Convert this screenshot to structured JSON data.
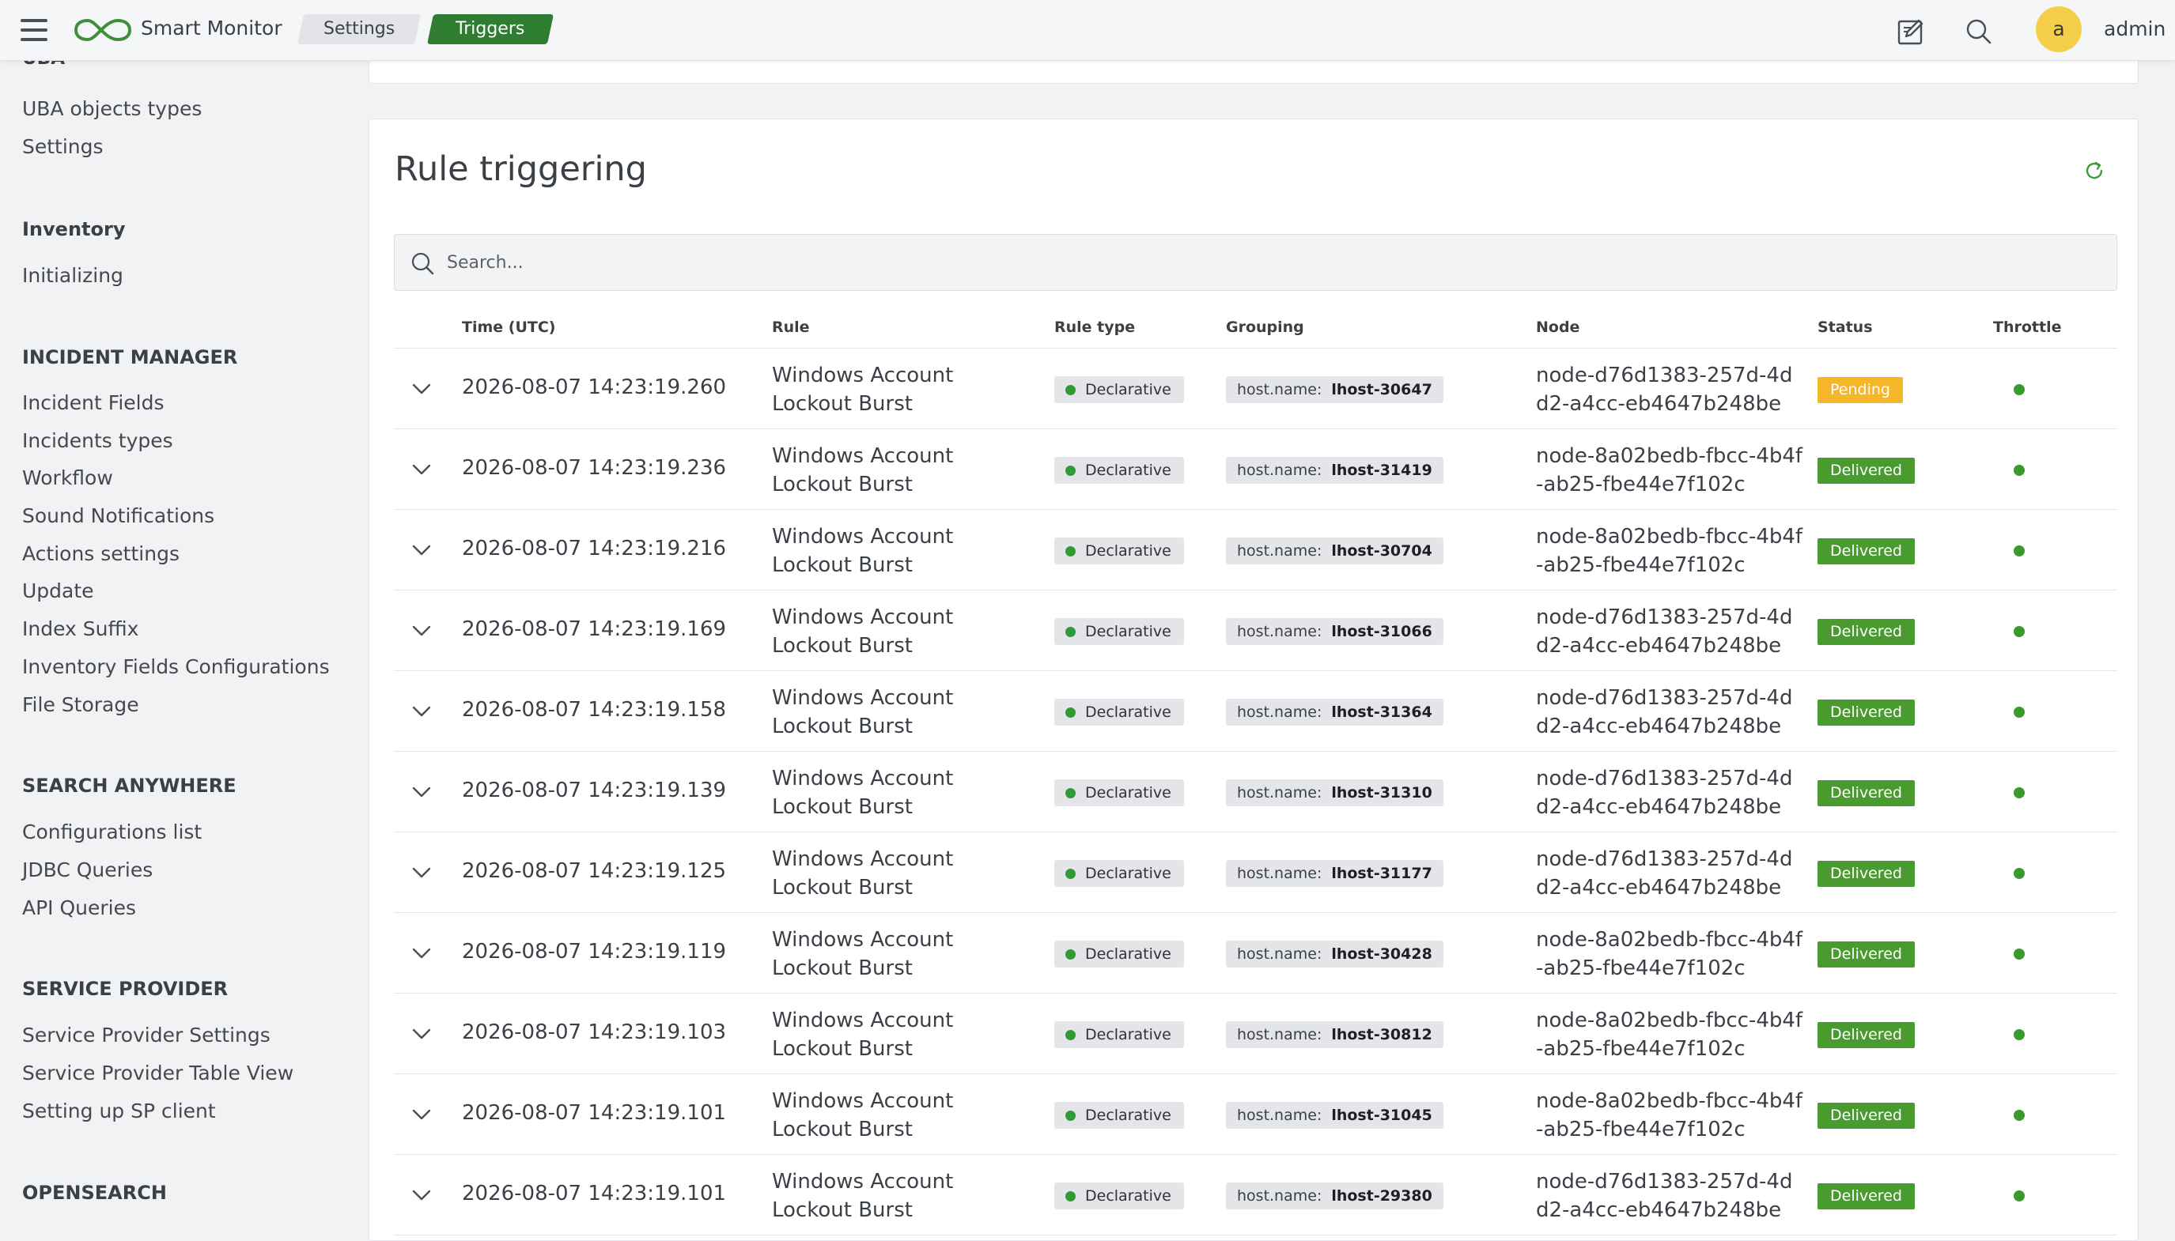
{
  "header": {
    "app_title": "Smart Monitor",
    "breadcrumbs": [
      "Settings",
      "Triggers"
    ],
    "user_initial": "a",
    "username": "admin",
    "accent_color": "#2f7d31"
  },
  "sidebar": {
    "cut_heading": "UBA",
    "sections": [
      {
        "heading": "",
        "items": [
          "UBA objects types",
          "Settings"
        ]
      },
      {
        "heading": "Inventory",
        "items": [
          "Initializing"
        ]
      },
      {
        "heading": "INCIDENT MANAGER",
        "items": [
          "Incident Fields",
          "Incidents types",
          "Workflow",
          "Sound Notifications",
          "Actions settings",
          "Update",
          "Index Suffix",
          "Inventory Fields Configurations",
          "File Storage"
        ]
      },
      {
        "heading": "SEARCH ANYWHERE",
        "items": [
          "Configurations list",
          "JDBC Queries",
          "API Queries"
        ]
      },
      {
        "heading": "SERVICE PROVIDER",
        "items": [
          "Service Provider Settings",
          "Service Provider Table View",
          "Setting up SP client"
        ]
      },
      {
        "heading": "OPENSEARCH",
        "items": []
      }
    ]
  },
  "main": {
    "title": "Rule triggering",
    "search_placeholder": "Search...",
    "columns": [
      "Time (UTC)",
      "Rule",
      "Rule type",
      "Grouping",
      "Node",
      "Status",
      "Throttle"
    ],
    "rows": [
      {
        "time": "2026-08-07 14:23:19.260",
        "rule": "Windows Account Lockout Burst",
        "rule_type": "Declarative",
        "group_key": "host.name:",
        "group_value": "lhost-30647",
        "node": "node-d76d1383-257d-4dd2-a4cc-eb4647b248be",
        "status": "Pending"
      },
      {
        "time": "2026-08-07 14:23:19.236",
        "rule": "Windows Account Lockout Burst",
        "rule_type": "Declarative",
        "group_key": "host.name:",
        "group_value": "lhost-31419",
        "node": "node-8a02bedb-fbcc-4b4f-ab25-fbe44e7f102c",
        "status": "Delivered"
      },
      {
        "time": "2026-08-07 14:23:19.216",
        "rule": "Windows Account Lockout Burst",
        "rule_type": "Declarative",
        "group_key": "host.name:",
        "group_value": "lhost-30704",
        "node": "node-8a02bedb-fbcc-4b4f-ab25-fbe44e7f102c",
        "status": "Delivered"
      },
      {
        "time": "2026-08-07 14:23:19.169",
        "rule": "Windows Account Lockout Burst",
        "rule_type": "Declarative",
        "group_key": "host.name:",
        "group_value": "lhost-31066",
        "node": "node-d76d1383-257d-4dd2-a4cc-eb4647b248be",
        "status": "Delivered"
      },
      {
        "time": "2026-08-07 14:23:19.158",
        "rule": "Windows Account Lockout Burst",
        "rule_type": "Declarative",
        "group_key": "host.name:",
        "group_value": "lhost-31364",
        "node": "node-d76d1383-257d-4dd2-a4cc-eb4647b248be",
        "status": "Delivered"
      },
      {
        "time": "2026-08-07 14:23:19.139",
        "rule": "Windows Account Lockout Burst",
        "rule_type": "Declarative",
        "group_key": "host.name:",
        "group_value": "lhost-31310",
        "node": "node-d76d1383-257d-4dd2-a4cc-eb4647b248be",
        "status": "Delivered"
      },
      {
        "time": "2026-08-07 14:23:19.125",
        "rule": "Windows Account Lockout Burst",
        "rule_type": "Declarative",
        "group_key": "host.name:",
        "group_value": "lhost-31177",
        "node": "node-d76d1383-257d-4dd2-a4cc-eb4647b248be",
        "status": "Delivered"
      },
      {
        "time": "2026-08-07 14:23:19.119",
        "rule": "Windows Account Lockout Burst",
        "rule_type": "Declarative",
        "group_key": "host.name:",
        "group_value": "lhost-30428",
        "node": "node-8a02bedb-fbcc-4b4f-ab25-fbe44e7f102c",
        "status": "Delivered"
      },
      {
        "time": "2026-08-07 14:23:19.103",
        "rule": "Windows Account Lockout Burst",
        "rule_type": "Declarative",
        "group_key": "host.name:",
        "group_value": "lhost-30812",
        "node": "node-8a02bedb-fbcc-4b4f-ab25-fbe44e7f102c",
        "status": "Delivered"
      },
      {
        "time": "2026-08-07 14:23:19.101",
        "rule": "Windows Account Lockout Burst",
        "rule_type": "Declarative",
        "group_key": "host.name:",
        "group_value": "lhost-31045",
        "node": "node-8a02bedb-fbcc-4b4f-ab25-fbe44e7f102c",
        "status": "Delivered"
      },
      {
        "time": "2026-08-07 14:23:19.101",
        "rule": "Windows Account Lockout Burst",
        "rule_type": "Declarative",
        "group_key": "host.name:",
        "group_value": "lhost-29380",
        "node": "node-d76d1383-257d-4dd2-a4cc-eb4647b248be",
        "status": "Delivered"
      }
    ],
    "status_colors": {
      "Delivered": "#4a9b2f",
      "Pending": "#f5b62a"
    },
    "icons": {
      "menu": "hamburger-icon",
      "logo": "infinity-logo-icon",
      "edit": "edit-icon",
      "search": "search-icon",
      "refresh": "refresh-icon",
      "expand": "chevron-down-icon",
      "throttle": "status-dot-icon"
    }
  }
}
